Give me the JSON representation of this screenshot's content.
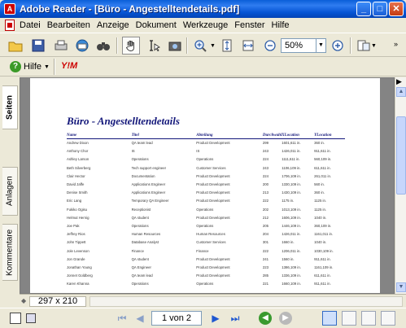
{
  "window": {
    "title": "Adobe Reader - [Büro - Angestelltendetails.pdf]",
    "app_icon": "adobe-reader-icon",
    "controls": [
      "minimize",
      "maximize",
      "close"
    ]
  },
  "menubar": {
    "items": [
      "Datei",
      "Bearbeiten",
      "Anzeige",
      "Dokument",
      "Werkzeuge",
      "Fenster",
      "Hilfe"
    ]
  },
  "toolbar": {
    "zoom_value": "50%",
    "help_label": "Hilfe",
    "yahoo_label": "Y!M"
  },
  "side_tabs": [
    "Seiten",
    "Anlagen",
    "Kommentare"
  ],
  "document": {
    "title": "Büro - Angestelltendetails",
    "columns": [
      "Name",
      "Titel",
      "Abteilung",
      "Durchwahl",
      "XLocation",
      "YLocation"
    ],
    "rows": [
      [
        "Andrew Dixon",
        "QA team lead",
        "Product Development",
        "299",
        "1601,611 in.",
        "360 in."
      ],
      [
        "Anthony Chor",
        "IS",
        "IS",
        "243",
        "1426,011 in.",
        "911,611 in."
      ],
      [
        "Ashley Larson",
        "Operations",
        "Operations",
        "224",
        "1111,611 in.",
        "560,109 in."
      ],
      [
        "Beth Silverberg",
        "Tech support engineer",
        "Customer Services",
        "243",
        "1106,109 in.",
        "611,611 in."
      ],
      [
        "Clair Hector",
        "Documentation",
        "Product Development",
        "224",
        "1706,109 in.",
        "261,011 in."
      ],
      [
        "David Jaffe",
        "Applications Engineer",
        "Product Development",
        "200",
        "1330,109 in.",
        "560 in."
      ],
      [
        "Denise Smith",
        "Applications Engineer",
        "Product Development",
        "213",
        "1430,109 in.",
        "360 in."
      ],
      [
        "Eric Lang",
        "Temporary QA Engineer",
        "Product Development",
        "222",
        "1175 in.",
        "1125 in."
      ],
      [
        "Fukiko Ogisu",
        "Receptionist",
        "Operations",
        "202",
        "1013,109 in.",
        "1125 in."
      ],
      [
        "Helmut Hernig",
        "QA student",
        "Product Development",
        "212",
        "1606,109 in.",
        "1040 in."
      ],
      [
        "Joe Pak",
        "Operations",
        "Operations",
        "205",
        "1446,109 in.",
        "360,109 in."
      ],
      [
        "Jeffrey Rios",
        "Human Resources",
        "Human Resources",
        "204",
        "1426,011 in.",
        "1161,011 in."
      ],
      [
        "John Tippett",
        "Database Analyst",
        "Customer Services",
        "301",
        "1660 in.",
        "1040 in."
      ],
      [
        "Jole Levenson",
        "Finance",
        "Finance",
        "222",
        "1206,011 in.",
        "1030,109 in."
      ],
      [
        "Jon Grande",
        "QA student",
        "Product Development",
        "241",
        "1560 in.",
        "911,611 in."
      ],
      [
        "Jonathan Young",
        "QA Engineer",
        "Product Development",
        "223",
        "1386,109 in.",
        "1161,109 in."
      ],
      [
        "Jonnet Goldberg",
        "QA team lead",
        "Product Development",
        "285",
        "1336,109 in.",
        "611,611 in."
      ],
      [
        "Karen Khanna",
        "Operations",
        "Operations",
        "221",
        "1660,109 in.",
        "911,611 in."
      ]
    ]
  },
  "footer": {
    "page_size": "297 x 210 mm",
    "page_indicator": "1 von 2"
  }
}
